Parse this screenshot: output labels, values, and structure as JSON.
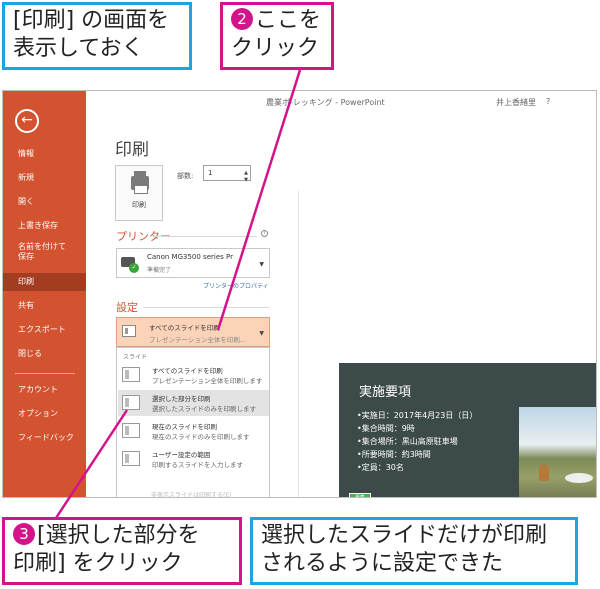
{
  "callouts": {
    "step1": "[印刷] の画面を\n表示しておく",
    "step2_num": "2",
    "step2": "ここを\nクリック",
    "step3_num": "3",
    "step3": "[選択した部分を\n印刷] をクリック",
    "result": "選択したスライドだけが印刷\nされるように設定できた"
  },
  "titlebar": {
    "title": "農業ボ-レッキング - PowerPoint",
    "user": "井上香緒里",
    "help": "?"
  },
  "backstage": {
    "back_icon": "back-arrow-icon",
    "items": [
      "情報",
      "新規",
      "開く",
      "上書き保存",
      "名前を付けて\n保存",
      "印刷",
      "共有",
      "エクスポート",
      "閉じる",
      "アカウント",
      "オプション",
      "フィードバック"
    ],
    "selected_index": 5
  },
  "print": {
    "title": "印刷",
    "button_label": "印刷",
    "copies_label": "部数:",
    "copies_value": "1"
  },
  "printer": {
    "header": "プリンター",
    "name": "Canon MG3500 series Pr",
    "status": "準備完了",
    "properties_link": "プリンターのプロパティ"
  },
  "settings": {
    "header": "設定",
    "dropdown_title": "すべてのスライドを印刷",
    "dropdown_sub": "プレゼンテーション全体を印刷..."
  },
  "menu": {
    "section": "スライド",
    "items": [
      {
        "title": "すべてのスライドを印刷",
        "desc": "プレゼンテーション全体を印刷します"
      },
      {
        "title": "選択した部分を印刷",
        "desc": "選択したスライドのみを印刷します"
      },
      {
        "title": "現在のスライドを印刷",
        "desc": "現在のスライドのみを印刷します"
      },
      {
        "title": "ユーザー設定の範囲",
        "desc": "印刷するスライドを入力します"
      }
    ],
    "highlighted_index": 1,
    "disabled_item": "非表示スライドは印刷する(E)"
  },
  "slide": {
    "title": "実施要項",
    "bullets": [
      "•実施日：2017年4月23日（日）",
      "•集合時間：9時",
      "•集合場所：黒山高原駐車場",
      "•所要時間：約3時間",
      "•定員：30名"
    ],
    "badge": "募集"
  },
  "colors": {
    "accent": "#d35230",
    "callout_blue": "#1aa6e0",
    "callout_magenta": "#d4138a"
  }
}
